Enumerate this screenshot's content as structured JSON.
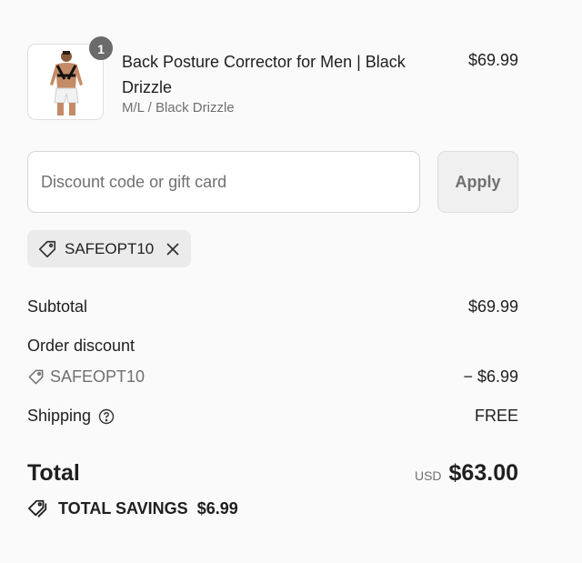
{
  "product": {
    "quantity": "1",
    "name": "Back Posture Corrector for Men | Black Drizzle",
    "variant": "M/L / Black Drizzle",
    "price": "$69.99",
    "image_icon": "product-photo-icon"
  },
  "discount": {
    "placeholder": "Discount code or gift card",
    "value": "",
    "apply_label": "Apply"
  },
  "applied_code": {
    "code": "SAFEOPT10",
    "tag_icon": "tag-icon",
    "remove_icon": "close-icon"
  },
  "summary": {
    "subtotal_label": "Subtotal",
    "subtotal_value": "$69.99",
    "order_discount_label": "Order discount",
    "discount_code": "SAFEOPT10",
    "discount_value": "− $6.99",
    "shipping_label": "Shipping",
    "shipping_value": "FREE",
    "total_label": "Total",
    "currency": "USD",
    "total_value": "$63.00"
  },
  "savings": {
    "label": "TOTAL SAVINGS",
    "value": "$6.99",
    "icon": "tags-icon"
  },
  "colors": {
    "background": "#fafafa",
    "text": "#1f1f1f",
    "muted": "#707070",
    "badge": "#6b6b6b",
    "chip": "#ebebeb"
  }
}
